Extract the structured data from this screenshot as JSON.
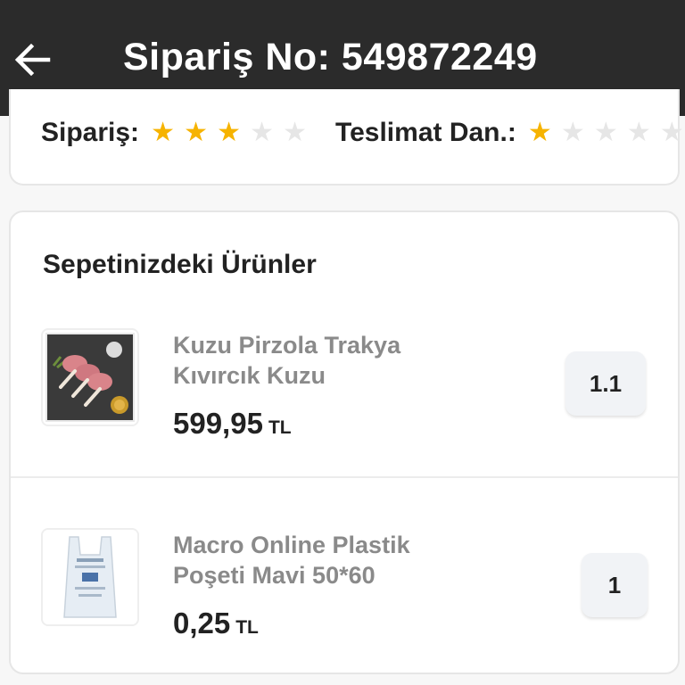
{
  "header": {
    "title": "Sipariş No: 549872249",
    "back_icon": "arrow-left-icon"
  },
  "ratings": {
    "order": {
      "label": "Sipariş:",
      "stars_filled": 3,
      "stars_total": 5
    },
    "delivery": {
      "label": "Teslimat Dan.:",
      "stars_filled": 1,
      "stars_total": 5
    }
  },
  "products": {
    "title": "Sepetinizdeki Ürünler",
    "items": [
      {
        "name": "Kuzu Pirzola Trakya Kıvırcık Kuzu",
        "price": "599,95",
        "currency": "TL",
        "quantity": "1.1",
        "image_icon": "lamb-chops-image"
      },
      {
        "name": "Macro Online Plastik Poşeti Mavi 50*60",
        "price": "0,25",
        "currency": "TL",
        "quantity": "1",
        "image_icon": "plastic-bag-image"
      }
    ]
  },
  "colors": {
    "appbar": "#2b2b2b",
    "star_filled": "#f6b300",
    "star_empty": "#e6e6e6",
    "product_name": "#8a8a8a",
    "text": "#222222"
  }
}
